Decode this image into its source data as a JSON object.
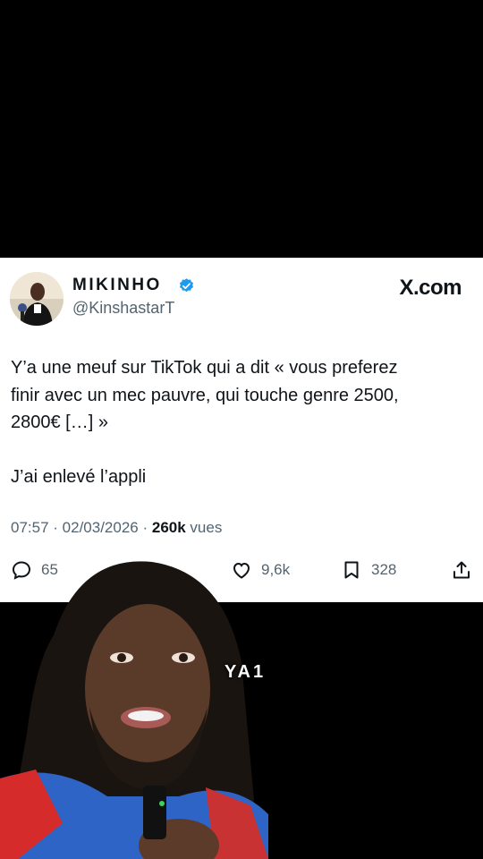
{
  "tweet": {
    "display_name": "MIKINHO",
    "handle": "@KinshastarT",
    "brand": "X.com",
    "text": "Y’a une meuf sur TikTok qui a dit « vous preferez\nfinir avec un mec pauvre, qui touche genre 2500,\n2800€ […] »\n\nJ’ai enlevé l’appli",
    "time": "07:57",
    "date": "02/03/2026",
    "views_count": "260k",
    "views_label": "vues",
    "replies": "65",
    "likes": "9,6k",
    "bookmarks": "328"
  },
  "video": {
    "overlay_text": "YA1"
  },
  "colors": {
    "verified": "#1d9bf0",
    "secondary_text": "#536471",
    "primary_text": "#0f1419"
  }
}
